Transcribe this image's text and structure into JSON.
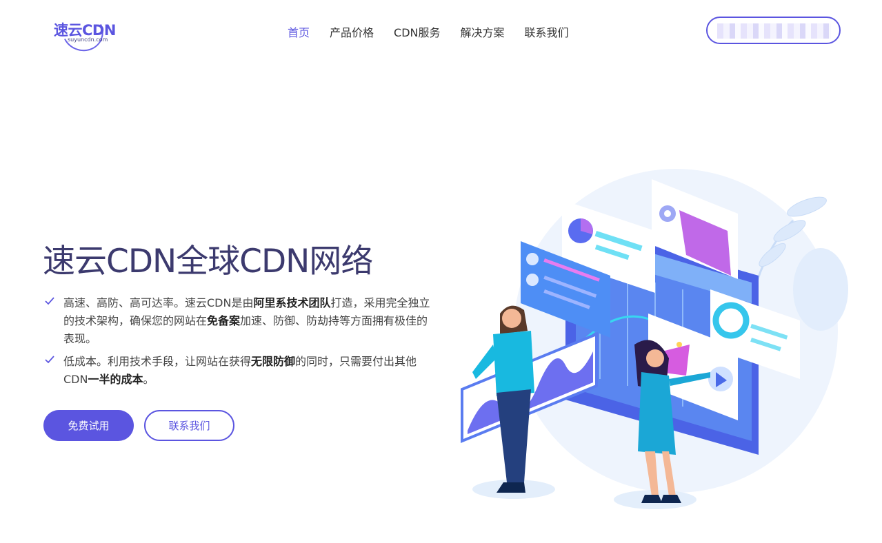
{
  "header": {
    "logo": {
      "text": "速云CDN",
      "sub": "suyuncdn.com"
    },
    "nav": [
      {
        "label": "首页",
        "active": true
      },
      {
        "label": "产品价格"
      },
      {
        "label": "CDN服务"
      },
      {
        "label": "解决方案"
      },
      {
        "label": "联系我们"
      }
    ]
  },
  "hero": {
    "title": "速云CDN全球CDN网络",
    "features": [
      {
        "parts": [
          "高速、高防、高可达率。速云CDN是由",
          "阿里系技术团队",
          "打造，采用完全独立的技术架构，确保您的网站在",
          "免备案",
          "加速、防御、防劫持等方面拥有极佳的表现。"
        ]
      },
      {
        "parts": [
          "低成本。利用技术手段，让网站在获得",
          "无限防御",
          "的同时，只需要付出其他CDN",
          "一半的成本",
          "。"
        ]
      }
    ],
    "buttons": {
      "primary": "免费试用",
      "secondary": "联系我们"
    }
  },
  "colors": {
    "accent": "#5b55e0",
    "title": "#3c3a6e"
  }
}
